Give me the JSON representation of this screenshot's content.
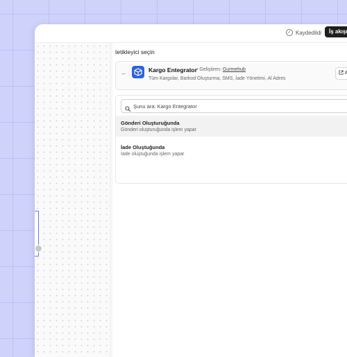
{
  "topbar": {
    "saved_label": "Kaydedildi",
    "saved_icon": "check-circle-icon",
    "workflow_button_label": "İş akışı"
  },
  "panel": {
    "title": "tetikleyici seçin",
    "app": {
      "name": "Kargo Entegrator",
      "developer_prefix": "• Geliştiren: ",
      "developer_name": "Gurmehub",
      "tags": "Tüm Kargolar, Barkod Oluşturma, SMS, İade Yönetimi, Al Adres",
      "open_button_label": "A",
      "icon": "package-icon"
    },
    "search": {
      "placeholder": "Şunu ara: Kargo Entegrator",
      "value": ""
    },
    "triggers": [
      {
        "title": "Gönderi Oluşturuğunda",
        "description": "Gönderi oluşturuğunda işlem yapar",
        "selected": true
      },
      {
        "title": "İade Oluştuğunda",
        "description": "İade oluştuğunda işlem yapar",
        "selected": false
      }
    ]
  },
  "colors": {
    "background": "#cfd2fb",
    "accent": "#2e64d3",
    "node_border": "#5d7de6",
    "dark_button": "#1f1f1f"
  }
}
